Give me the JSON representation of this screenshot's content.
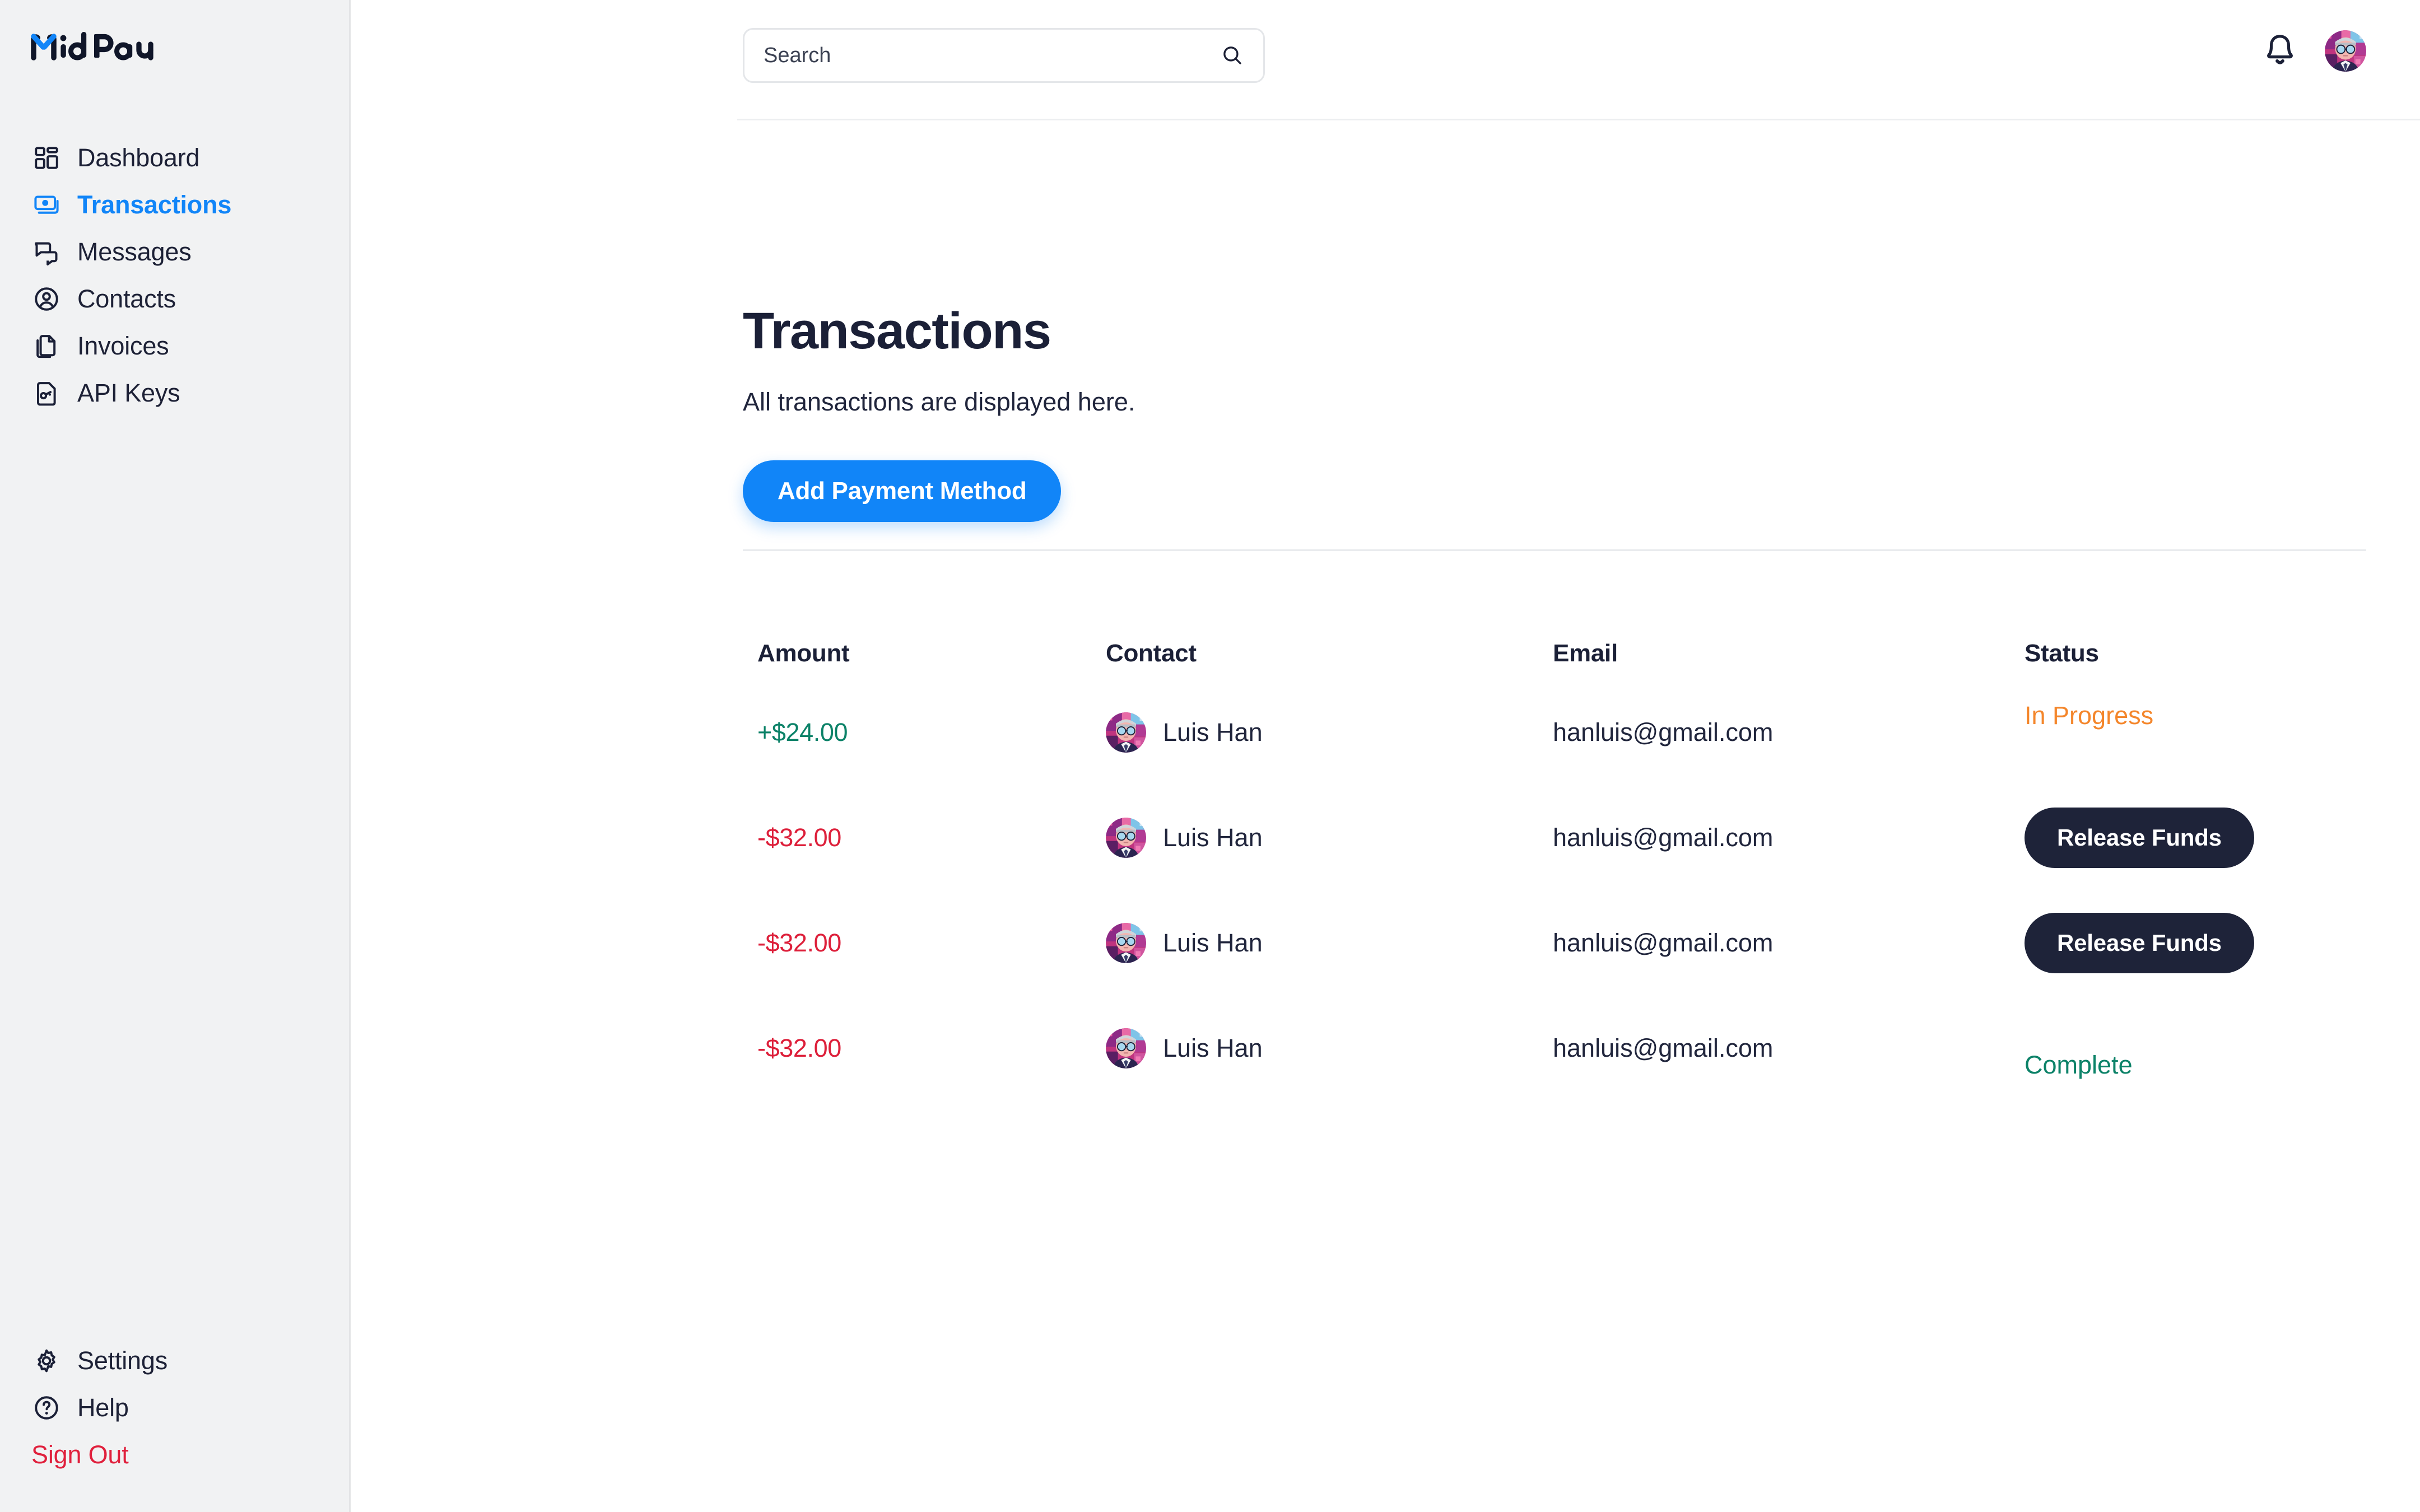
{
  "brand": {
    "name": "MidPay",
    "accent": "#1185f8",
    "dark": "#101629"
  },
  "search": {
    "placeholder": "Search",
    "value": "",
    "icon": "search-icon"
  },
  "topbar": {
    "notifications_icon": "bell-icon",
    "avatar_icon": "user-avatar"
  },
  "sidebar": {
    "items": [
      {
        "label": "Dashboard",
        "icon": "grid-icon",
        "active": false
      },
      {
        "label": "Transactions",
        "icon": "banknote-icon",
        "active": true
      },
      {
        "label": "Messages",
        "icon": "chat-icon",
        "active": false
      },
      {
        "label": "Contacts",
        "icon": "user-circle-icon",
        "active": false
      },
      {
        "label": "Invoices",
        "icon": "documents-icon",
        "active": false
      },
      {
        "label": "API Keys",
        "icon": "key-document-icon",
        "active": false
      }
    ],
    "bottom_items": [
      {
        "label": "Settings",
        "icon": "gear-icon"
      },
      {
        "label": "Help",
        "icon": "question-circle-icon"
      },
      {
        "label": "Sign Out",
        "icon": "none",
        "color": "#e0203c"
      }
    ]
  },
  "page": {
    "title": "Transactions",
    "subtitle": "All transactions are displayed here.",
    "primary_action": "Add Payment Method"
  },
  "table": {
    "columns": [
      "Amount",
      "Contact",
      "Email",
      "Status"
    ],
    "rows": [
      {
        "amount": "+$24.00",
        "amount_sign": "positive",
        "contact": "Luis Han",
        "email": "hanluis@gmail.com",
        "status_type": "text",
        "status": "In Progress",
        "status_color": "#f4862b",
        "has_menu": true
      },
      {
        "amount": "-$32.00",
        "amount_sign": "negative",
        "contact": "Luis Han",
        "email": "hanluis@gmail.com",
        "status_type": "button",
        "status": "Release Funds",
        "status_color": "#1e2339",
        "has_menu": true
      },
      {
        "amount": "-$32.00",
        "amount_sign": "negative",
        "contact": "Luis Han",
        "email": "hanluis@gmail.com",
        "status_type": "button",
        "status": "Release Funds",
        "status_color": "#1e2339",
        "has_menu": true
      },
      {
        "amount": "-$32.00",
        "amount_sign": "negative",
        "contact": "Luis Han",
        "email": "hanluis@gmail.com",
        "status_type": "text",
        "status": "Complete",
        "status_color": "#0c8268",
        "has_menu": false
      }
    ]
  }
}
